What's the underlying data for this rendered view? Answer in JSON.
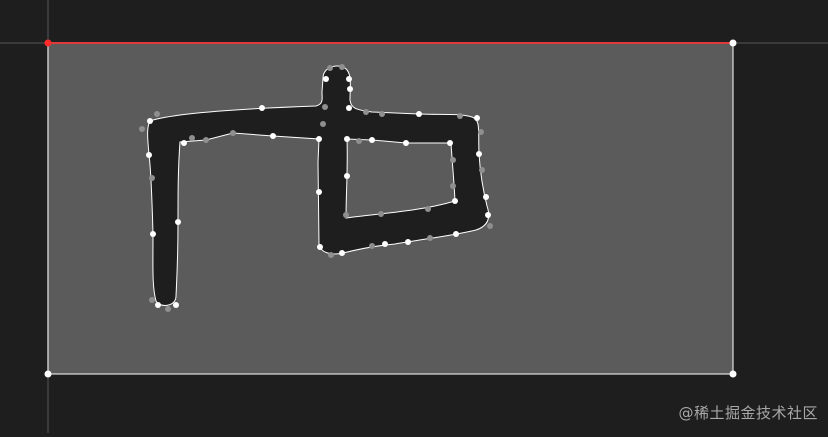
{
  "canvas": {
    "background_color": "#1e1e1e",
    "artboard_color": "#5b5b5b",
    "glyph_fill_color": "#1e1e1e",
    "outline_color": "#ffffff",
    "guide_color": "#3a3a3a",
    "selected_edge_color": "#e03a3a",
    "selected_corner_color": "#ff2a2a",
    "point_color_on_curve": "#ffffff",
    "point_color_off_curve": "#8f8f8f"
  },
  "glyph": {
    "shape": "stroked path (gong-like character) with inner counter"
  },
  "watermark": {
    "text": "@稀土掘金技术社区"
  }
}
